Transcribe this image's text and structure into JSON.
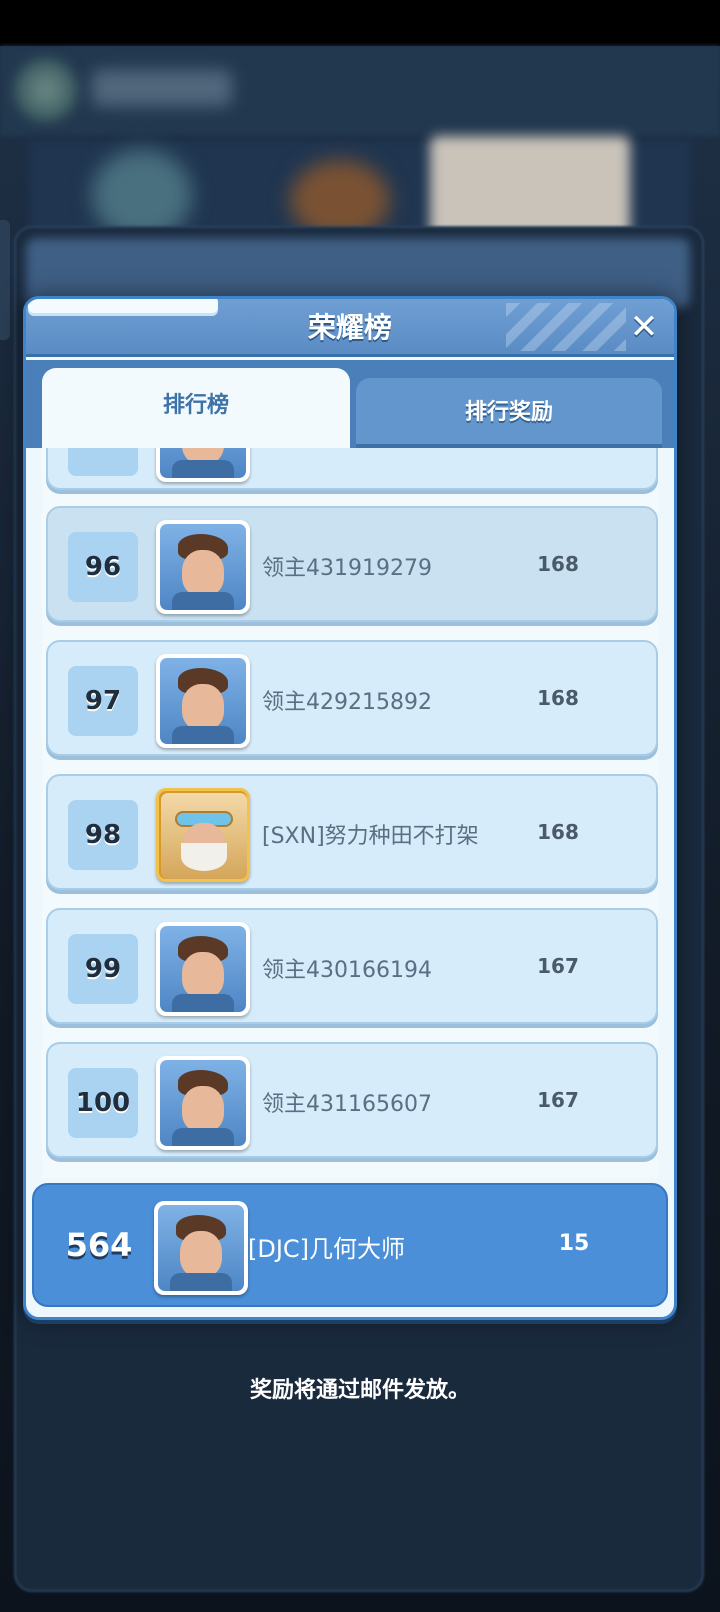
{
  "dialog": {
    "title": "荣耀榜",
    "close_icon": "close-icon",
    "tabs": [
      {
        "label": "排行榜",
        "active": true
      },
      {
        "label": "排行奖励",
        "active": false
      }
    ]
  },
  "rankings": [
    {
      "rank": "96",
      "name": "领主431919279",
      "score": "168",
      "avatar": "male-lord-portrait"
    },
    {
      "rank": "97",
      "name": "领主429215892",
      "score": "168",
      "avatar": "male-lord-portrait"
    },
    {
      "rank": "98",
      "name": "[SXN]努力种田不打架",
      "score": "168",
      "avatar": "goggles-dwarf-portrait-gold-frame"
    },
    {
      "rank": "99",
      "name": "领主430166194",
      "score": "167",
      "avatar": "male-lord-portrait"
    },
    {
      "rank": "100",
      "name": "领主431165607",
      "score": "167",
      "avatar": "male-lord-portrait"
    }
  ],
  "self": {
    "rank": "564",
    "name": "[DJC]几何大师",
    "score": "15",
    "avatar": "male-lord-portrait"
  },
  "footer_note": "奖励将通过邮件发放。",
  "colors": {
    "header_blue": "#5a8bc4",
    "self_row_blue": "#4b8fd9",
    "row_bg": "#d7ecfa",
    "gold_frame": "#d49a2a"
  }
}
